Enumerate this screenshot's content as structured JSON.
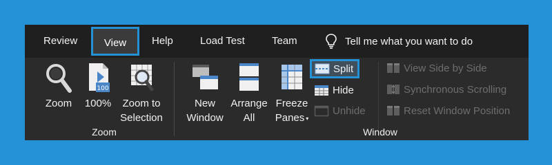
{
  "tabs": [
    {
      "label": "Review"
    },
    {
      "label": "View",
      "active": true
    },
    {
      "label": "Help"
    },
    {
      "label": "Load Test"
    },
    {
      "label": "Team"
    }
  ],
  "tell_me": {
    "text": "Tell me what you want to do",
    "icon": "lightbulb-icon"
  },
  "zoom_group": {
    "label": "Zoom",
    "buttons": [
      {
        "label": "Zoom",
        "icon": "magnifier-icon"
      },
      {
        "label": "100%",
        "icon": "zoom-100-icon"
      },
      {
        "line1": "Zoom to",
        "line2": "Selection",
        "icon": "zoom-to-selection-icon"
      }
    ]
  },
  "window_group": {
    "label": "Window",
    "new_window": {
      "line1": "New",
      "line2": "Window",
      "icon": "new-window-icon"
    },
    "arrange_all": {
      "line1": "Arrange",
      "line2": "All",
      "icon": "arrange-all-icon"
    },
    "freeze_panes": {
      "line1": "Freeze",
      "line2": "Panes",
      "dropdown": "▾",
      "icon": "freeze-panes-icon"
    },
    "split": {
      "label": "Split",
      "icon": "split-icon"
    },
    "hide": {
      "label": "Hide",
      "icon": "hide-icon"
    },
    "unhide": {
      "label": "Unhide",
      "icon": "unhide-icon"
    },
    "view_side_by_side": {
      "label": "View Side by Side",
      "icon": "side-by-side-icon"
    },
    "synchronous_scrolling": {
      "label": "Synchronous Scrolling",
      "icon": "sync-scroll-icon"
    },
    "reset_window_position": {
      "label": "Reset Window Position",
      "icon": "reset-position-icon"
    }
  },
  "colors": {
    "background": "#2591d6",
    "tabbar": "#1f1f1f",
    "ribbon": "#2b2b2b",
    "text": "#f0f0f0",
    "disabled": "#6e6e6e",
    "accent": "#2591d6",
    "icon_blue": "#4a86c8"
  }
}
